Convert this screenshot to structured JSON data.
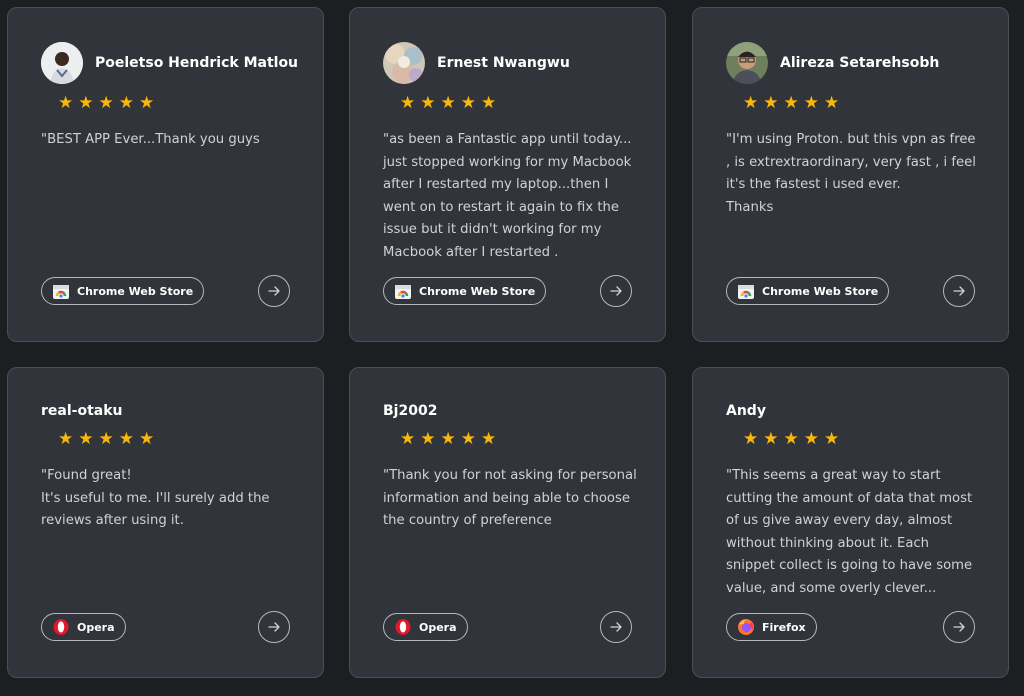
{
  "reviews": [
    {
      "name": "Poeletso Hendrick Matlou",
      "rating": 5,
      "text": "\"BEST APP Ever...Thank you guys",
      "store": "Chrome Web Store",
      "store_icon": "chrome-web-store-icon",
      "avatar": true
    },
    {
      "name": "Ernest Nwangwu",
      "rating": 5,
      "text": "\"as been a Fantastic app until today...\njust stopped working for my Macbook\nafter I restarted my laptop...then I\nwent on to restart it again to fix the\nissue but it didn't working for my\nMacbook after I restarted .",
      "store": "Chrome Web Store",
      "store_icon": "chrome-web-store-icon",
      "avatar": true
    },
    {
      "name": "Alireza Setarehsobh",
      "rating": 5,
      "text": "\"I'm using Proton. but this vpn as free\n, is extrextraordinary, very fast , i feel\nit's the fastest i used ever.\nThanks",
      "store": "Chrome Web Store",
      "store_icon": "chrome-web-store-icon",
      "avatar": true
    },
    {
      "name": "real-otaku",
      "rating": 5,
      "text": "\"Found great!\nIt's useful to me. I'll surely add the\nreviews after using it.",
      "store": "Opera",
      "store_icon": "opera-icon",
      "avatar": false
    },
    {
      "name": "Bj2002",
      "rating": 5,
      "text": "\"Thank you for not asking for personal\ninformation and being able to choose\nthe country of preference",
      "store": "Opera",
      "store_icon": "opera-icon",
      "avatar": false
    },
    {
      "name": "Andy",
      "rating": 5,
      "text": "\"This seems a great way to start\ncutting the amount of data that most\nof us give away every day, almost\nwithout thinking about it. Each\nsnippet collect is going to have some\nvalue, and some overly clever...",
      "store": "Firefox",
      "store_icon": "firefox-icon",
      "avatar": false
    }
  ],
  "star_glyph": "★",
  "colors": {
    "background": "#1c1e22",
    "card": "#31343a",
    "star": "#f6b80e"
  }
}
